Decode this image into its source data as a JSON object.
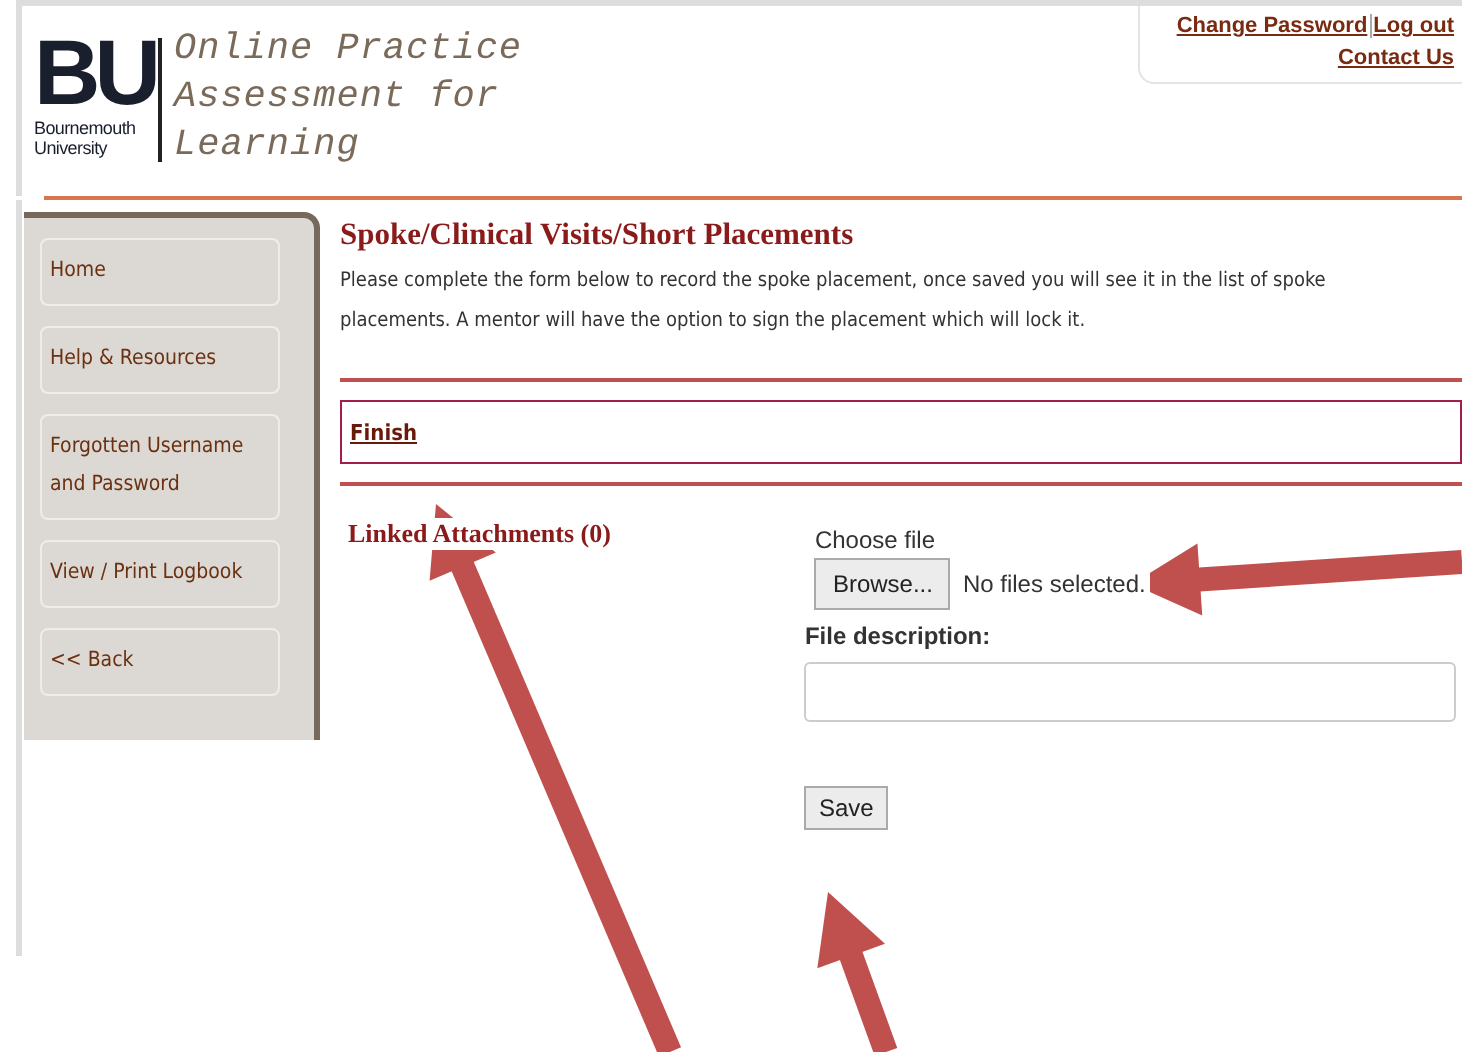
{
  "header": {
    "logo": {
      "letters": "BU",
      "name_line_1": "Bournemouth",
      "name_line_2": "University"
    },
    "title_lines": [
      "Online Practice",
      "Assessment for",
      "Learning"
    ],
    "links_row_1": [
      {
        "label": "Change Password"
      },
      {
        "label": "Log out"
      }
    ],
    "links_row_2": [
      {
        "label": "Contact Us"
      }
    ]
  },
  "sidebar": {
    "items": [
      {
        "label": "Home"
      },
      {
        "label": "Help & Resources"
      },
      {
        "label": "Forgotten Username and Password"
      },
      {
        "label": "View / Print Logbook"
      },
      {
        "label": "<< Back"
      }
    ]
  },
  "content": {
    "title": "Spoke/Clinical Visits/Short Placements",
    "intro": "Please complete the form below to record the spoke placement, once saved you will see it in the list of spoke placements.  A mentor will have the option to sign the placement which will lock it.",
    "finish_link": "Finish",
    "attachments_heading": "Linked Attachments (0)",
    "upload": {
      "choose_label": "Choose file",
      "browse_button": "Browse...",
      "file_status": "No files selected.",
      "description_label": "File description:",
      "save_button": "Save"
    }
  },
  "annotations": [
    {
      "kind": "arrow"
    },
    {
      "kind": "arrow"
    },
    {
      "kind": "arrow"
    }
  ]
}
